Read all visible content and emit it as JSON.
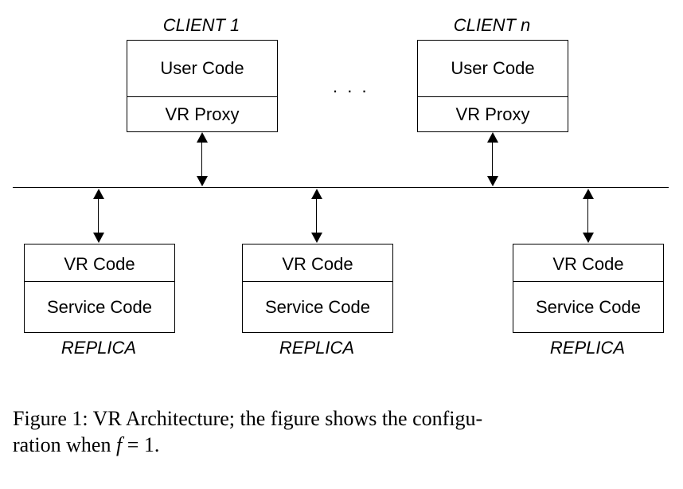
{
  "clients": [
    {
      "title": "CLIENT 1",
      "top": "User Code",
      "bottom": "VR Proxy"
    },
    {
      "title": "CLIENT n",
      "top": "User Code",
      "bottom": "VR Proxy"
    }
  ],
  "ellipsis": ". . .",
  "replicas": [
    {
      "label": "REPLICA",
      "top": "VR Code",
      "bottom": "Service Code"
    },
    {
      "label": "REPLICA",
      "top": "VR Code",
      "bottom": "Service Code"
    },
    {
      "label": "REPLICA",
      "top": "VR Code",
      "bottom": "Service Code"
    }
  ],
  "caption": {
    "prefix": "Figure 1: VR Architecture; the figure shows the configu-",
    "line2a": "ration when ",
    "var": "f",
    "eq": " = 1."
  }
}
